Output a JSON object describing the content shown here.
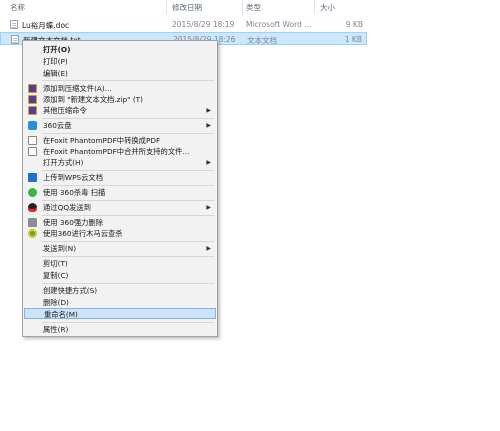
{
  "columns": {
    "name": "名称",
    "modified": "修改日期",
    "type": "类型",
    "size": "大小"
  },
  "files": [
    {
      "name": "Lu裕月蝶.doc",
      "modified": "2015/8/29 18:19",
      "type": "Microsoft Word ...",
      "size": "9 KB"
    },
    {
      "name": "新建文本文档.txt",
      "modified": "2015/8/29 18:26",
      "type": "文本文档",
      "size": "1 KB"
    }
  ],
  "menu": {
    "open": "打开(O)",
    "print": "打印(P)",
    "edit": "编辑(E)",
    "add_archive": "添加到压缩文件(A)...",
    "add_zip": "添加到 \"新建文本文档.zip\" (T)",
    "other_compress": "其他压缩命令",
    "cloud360": "360云盘",
    "foxit_convert": "在Foxit PhantomPDF中转换成PDF",
    "foxit_merge": "在Foxit PhantomPDF中合并所支持的文件...",
    "open_with": "打开方式(H)",
    "wps_upload": "上传到WPS云文档",
    "scan360": "使用 360杀毒 扫描",
    "qq_send": "通过QQ发送到",
    "force_delete": "使用 360强力删除",
    "trojan_scan": "使用360进行木马云查杀",
    "send_to": "发送到(N)",
    "cut": "剪切(T)",
    "copy": "复制(C)",
    "create_shortcut": "创建快捷方式(S)",
    "delete": "删除(D)",
    "rename": "重命名(M)",
    "properties": "属性(R)"
  },
  "colors": {
    "selection": "#cce8ff",
    "highlight": "#cde3f7"
  }
}
